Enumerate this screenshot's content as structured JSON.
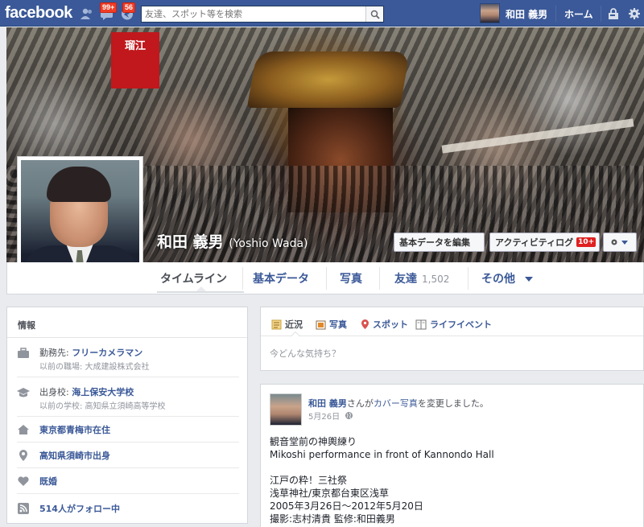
{
  "topbar": {
    "logo": "facebook",
    "friend_requests_icon": "friends-icon",
    "messages_badge": "99+",
    "notifications_badge": "56",
    "search_placeholder": "友達、スポット等を検索",
    "user_name": "和田 義男",
    "home": "ホーム",
    "color": "#3b5998"
  },
  "cover": {
    "sign_text": "瑠江",
    "name": "和田 義男",
    "alt_name": "(Yoshio Wada)",
    "edit_button": "基本データを編集",
    "activity_button": "アクティビティログ",
    "activity_count": "10+"
  },
  "tabs": [
    {
      "label": "タイムライン"
    },
    {
      "label": "基本データ"
    },
    {
      "label": "写真"
    },
    {
      "label": "友達",
      "count": "1,502"
    },
    {
      "label": "その他"
    }
  ],
  "info": {
    "title": "情報",
    "work_prefix": "勤務先: ",
    "work": "フリーカメラマン",
    "work_prev": "以前の職場: 大成建設株式会社",
    "school_prefix": "出身校: ",
    "school": "海上保安大学校",
    "school_prev": "以前の学校: 高知県立須崎高等学校",
    "lives": "東京都青梅市在住",
    "from": "高知県須崎市出身",
    "relationship": "既婚",
    "followers": "514人がフォロー中"
  },
  "composer": {
    "tabs": [
      "近況",
      "写真",
      "スポット",
      "ライフイベント"
    ],
    "placeholder": "今どんな気持ち？"
  },
  "post": {
    "author": "和田 義男",
    "action_1": "さんが",
    "action_link": "カバー写真",
    "action_2": "を変更しました。",
    "date": "5月26日",
    "lines": [
      "観音堂前の神輿練り",
      "Mikoshi performance in front of Kannondo Hall",
      "",
      "江戸の粋！三社祭",
      "浅草神社/東京都台東区浅草",
      "2005年3月26日～2012年5月20日",
      "撮影:志村清貴 監修:和田義男"
    ]
  }
}
